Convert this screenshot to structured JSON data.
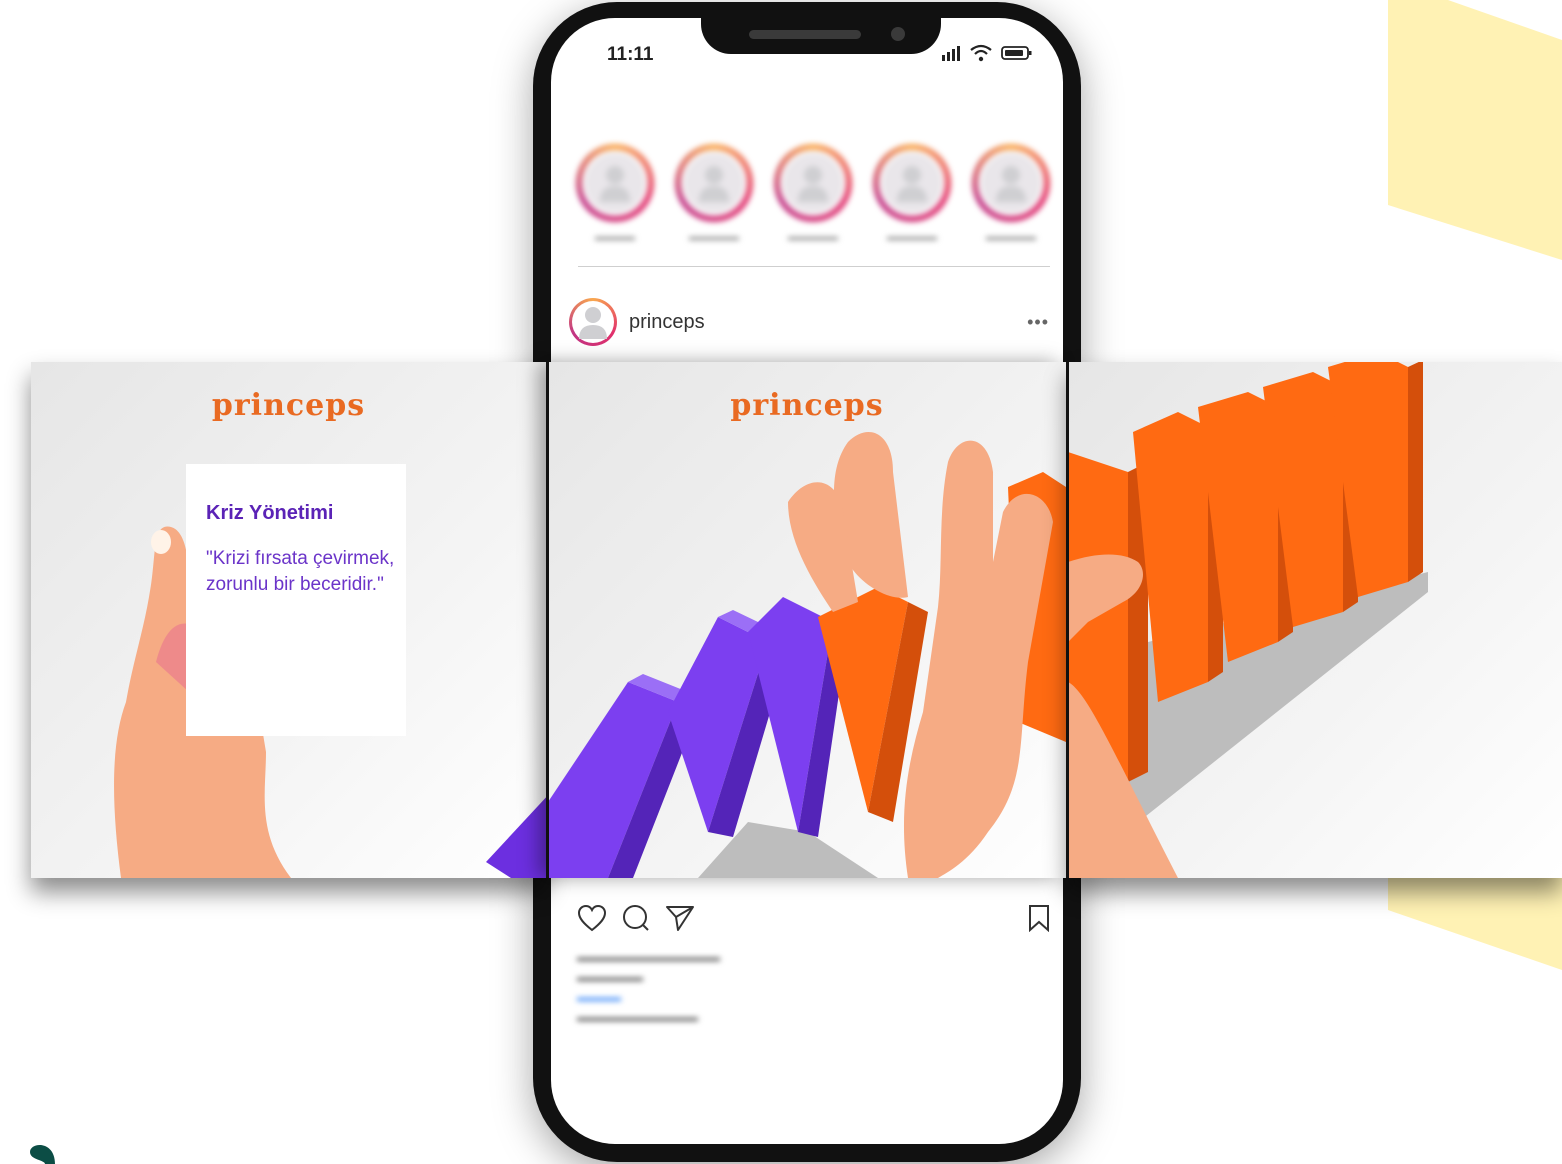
{
  "status_bar": {
    "time": "11:11"
  },
  "post": {
    "username": "princeps",
    "more": "•••"
  },
  "slides": [
    {
      "brand": "princeps",
      "card_title": "Kriz Yönetimi",
      "card_quote": "\"Krizi fırsata çevirmek, zorunlu bir beceridir.\""
    },
    {
      "brand": "princeps"
    },
    {}
  ],
  "colors": {
    "brand": "#e96a22",
    "purple": "#6c2fe0",
    "orange": "#ff6a12",
    "yellow": "#fff2b4",
    "skin": "#f6ab84"
  },
  "icons": [
    "signal-icon",
    "wifi-icon",
    "battery-icon",
    "heart-icon",
    "comment-icon",
    "share-icon",
    "bookmark-icon"
  ]
}
